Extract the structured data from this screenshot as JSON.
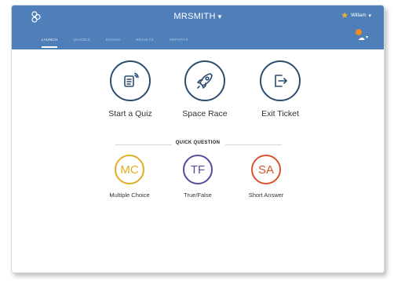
{
  "header": {
    "class_name": "MRSMITH",
    "user_name": "William",
    "notification_count": "",
    "tabs": [
      {
        "label": "Launch",
        "active": true
      },
      {
        "label": "Quizzes",
        "active": false
      },
      {
        "label": "Rooms",
        "active": false
      },
      {
        "label": "Results",
        "active": false
      },
      {
        "label": "Reports",
        "active": false
      }
    ]
  },
  "launch": [
    {
      "label": "Start a Quiz",
      "icon": "quiz-icon"
    },
    {
      "label": "Space Race",
      "icon": "rocket-icon"
    },
    {
      "label": "Exit Ticket",
      "icon": "exit-icon"
    }
  ],
  "quick_question": {
    "title": "QUICK QUESTION",
    "items": [
      {
        "abbr": "MC",
        "label": "Multiple Choice",
        "color": "#e0ae22"
      },
      {
        "abbr": "TF",
        "label": "True/False",
        "color": "#5e4a9e"
      },
      {
        "abbr": "SA",
        "label": "Short Answer",
        "color": "#d9532b"
      }
    ]
  },
  "colors": {
    "header": "#4e7fb8",
    "launch_icon": "#2c4d70"
  }
}
